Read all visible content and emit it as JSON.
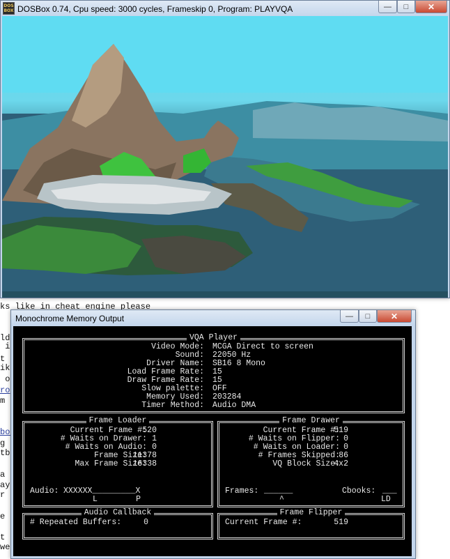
{
  "background_page": {
    "line_1": "ks like in cheat engine please",
    "fragments": [
      "ld",
      " in",
      "t s",
      "ike",
      " of",
      "rop",
      "m",
      "box",
      "g e",
      "tbo",
      "a h",
      "aye",
      "r l",
      "e g",
      "t f",
      "wer"
    ]
  },
  "dosbox_window": {
    "title": "DOSBox 0.74, Cpu speed:     3000 cycles, Frameskip  0, Program:  PLAYVQA",
    "icon_text": "DOS BOX",
    "minimize": "—",
    "maximize": "□",
    "close": "✕"
  },
  "monochrome_window": {
    "title": "Monochrome Memory Output",
    "minimize": "—",
    "maximize": "□",
    "close": "✕",
    "vqa_player": {
      "title": "VQA Player",
      "labels": [
        "Video Mode:",
        "Sound:",
        "Driver Name:",
        "Load Frame Rate:",
        "Draw Frame Rate:",
        "Slow palette:",
        "Memory Used:",
        "Timer Method:"
      ],
      "values": [
        "MCGA Direct to screen",
        "22050 Hz",
        "SB16 8 Mono",
        "15",
        "15",
        "OFF",
        "203284",
        "Audio DMA"
      ]
    },
    "frame_loader": {
      "title": "Frame Loader",
      "labels": [
        "Current Frame #:",
        "# Waits on Drawer:",
        "# Waits on Audio:",
        "Frame Size:",
        "Max Frame Size:"
      ],
      "values": [
        "520",
        "1",
        "0",
        "11378",
        "16338"
      ],
      "audio_label": "Audio:",
      "audio_bar": "XXXXXX_________X",
      "audio_markers": "L        P"
    },
    "frame_drawer": {
      "title": "Frame Drawer",
      "labels": [
        "Current Frame #:",
        "# Waits on Flipper:",
        "# Waits on Loader:",
        "# Frames Skipped:",
        "VQ Block Size:"
      ],
      "values": [
        "519",
        "0",
        "0",
        "86",
        "4x2"
      ],
      "frames_label": "Frames:",
      "frames_bar": "______",
      "frames_marker": "^",
      "cbooks_label": "Cbooks:",
      "cbooks_bar": "___",
      "cbooks_marker": "LD"
    },
    "audio_callback": {
      "title": "Audio Callback",
      "label": "# Repeated Buffers:",
      "value": "0"
    },
    "frame_flipper": {
      "title": "Frame Flipper",
      "label": "Current Frame #:",
      "value": "519"
    }
  }
}
